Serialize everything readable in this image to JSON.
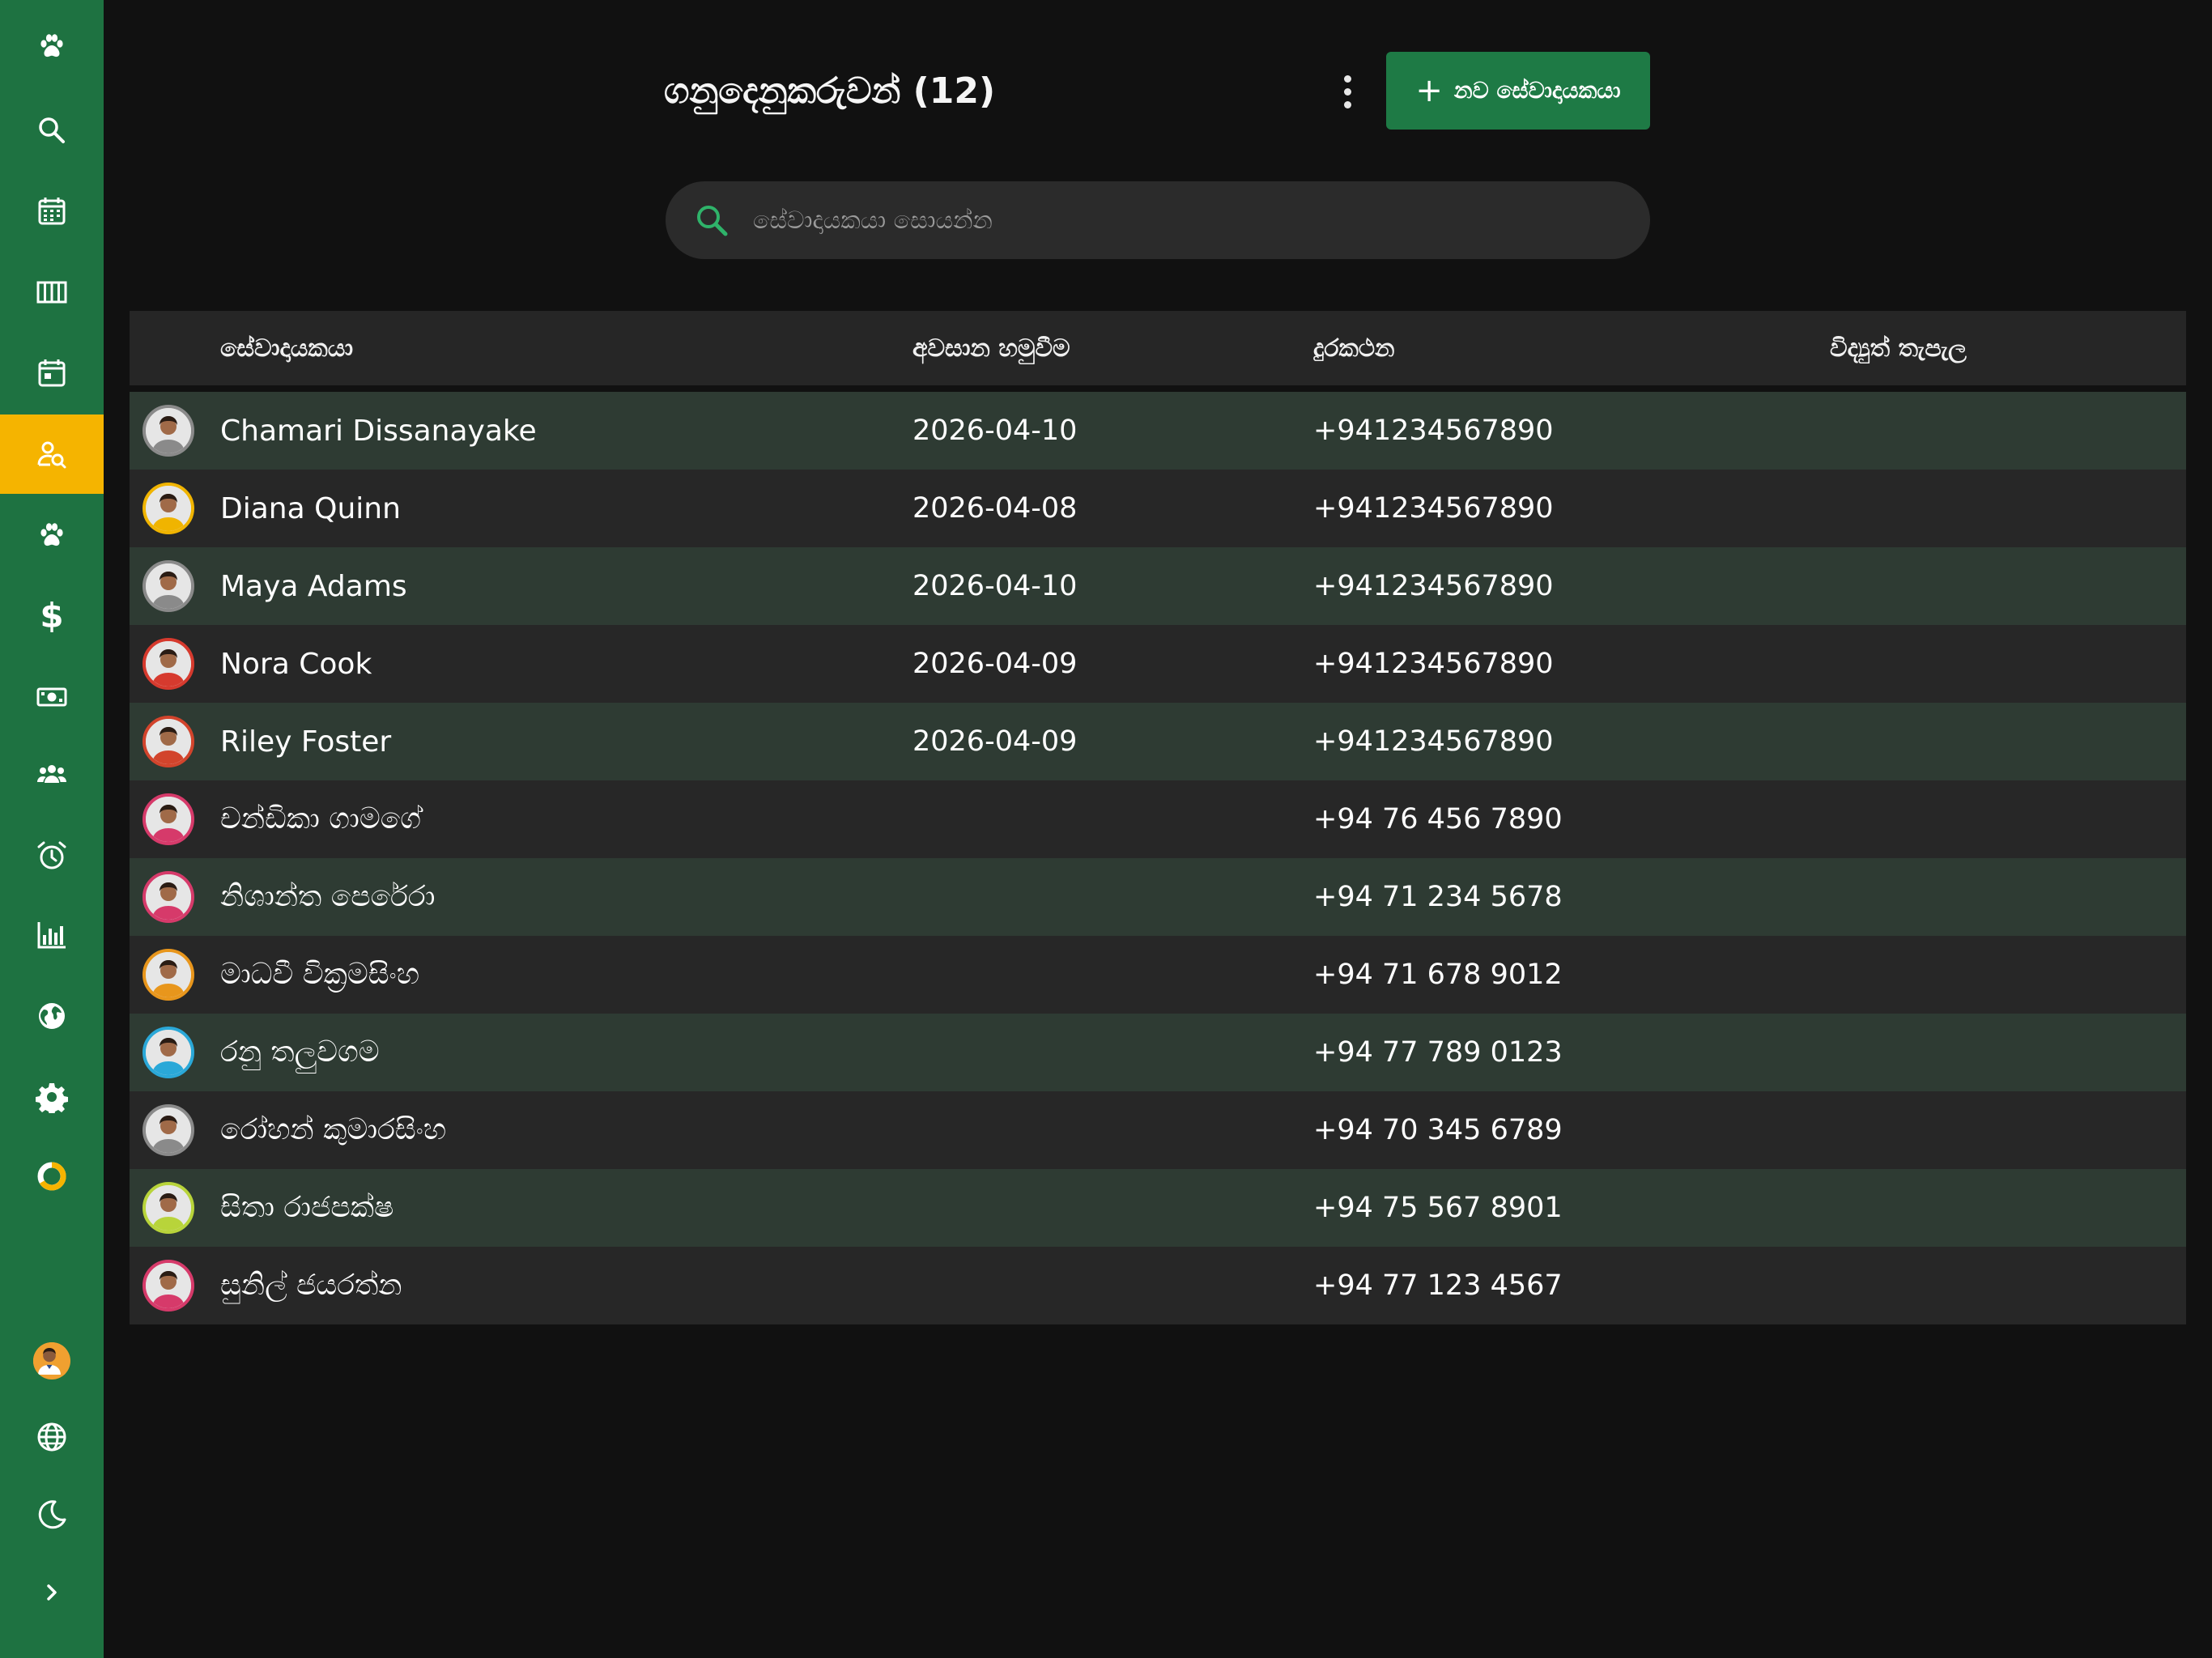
{
  "sidebar": {
    "items": [
      {
        "icon": "paw-logo-icon"
      },
      {
        "icon": "search-icon"
      },
      {
        "icon": "calendar-grid-icon"
      },
      {
        "icon": "columns-icon"
      },
      {
        "icon": "calendar-day-icon"
      },
      {
        "icon": "user-search-icon",
        "active": true
      },
      {
        "icon": "paw-icon"
      },
      {
        "icon": "dollar-icon",
        "label": "$"
      },
      {
        "icon": "banknote-icon"
      },
      {
        "icon": "users-group-icon"
      },
      {
        "icon": "alarm-clock-icon"
      },
      {
        "icon": "bar-chart-icon"
      },
      {
        "icon": "globe-filled-icon"
      },
      {
        "icon": "settings-gear-icon"
      },
      {
        "icon": "progress-ring-icon"
      }
    ],
    "bottom": [
      {
        "icon": "user-avatar"
      },
      {
        "icon": "language-globe-icon"
      },
      {
        "icon": "moon-icon"
      },
      {
        "icon": "chevron-right-icon"
      }
    ],
    "active_color": "#f5b400",
    "background_color": "#1e7241"
  },
  "header": {
    "title": "ගනුදෙනුකරුවන් (12)",
    "add_button_label": "නව සේවාදායකයා",
    "add_button_color": "#1e7a45"
  },
  "search": {
    "placeholder": "සේවාදායකයා සොයන්න",
    "value": ""
  },
  "table": {
    "columns": [
      "සේවාදායකයා",
      "අවසාන හමුවීම",
      "දුරකථන",
      "විද්‍යුත් තැපැල"
    ],
    "rows": [
      {
        "name": "Chamari Dissanayake",
        "last_visit": "2026-04-10",
        "phone": "+941234567890",
        "email": "",
        "avatar_color": "#8a8a8a"
      },
      {
        "name": "Diana Quinn",
        "last_visit": "2026-04-08",
        "phone": "+941234567890",
        "email": "",
        "avatar_color": "#f0b400"
      },
      {
        "name": "Maya Adams",
        "last_visit": "2026-04-10",
        "phone": "+941234567890",
        "email": "",
        "avatar_color": "#8a8a8a"
      },
      {
        "name": "Nora Cook",
        "last_visit": "2026-04-09",
        "phone": "+941234567890",
        "email": "",
        "avatar_color": "#d63a2e"
      },
      {
        "name": "Riley Foster",
        "last_visit": "2026-04-09",
        "phone": "+941234567890",
        "email": "",
        "avatar_color": "#d2442c"
      },
      {
        "name": "චන්ඩිකා ගාමගේ",
        "last_visit": "",
        "phone": "+94 76 456 7890",
        "email": "",
        "avatar_color": "#d63a6a"
      },
      {
        "name": "නිශාන්ත පෙරේරා",
        "last_visit": "",
        "phone": "+94 71 234 5678",
        "email": "",
        "avatar_color": "#d63a6a"
      },
      {
        "name": "මාධවී වික්‍රමසිංහ",
        "last_visit": "",
        "phone": "+94 71 678 9012",
        "email": "",
        "avatar_color": "#e8961c"
      },
      {
        "name": "රනු තලුවගම",
        "last_visit": "",
        "phone": "+94 77 789 0123",
        "email": "",
        "avatar_color": "#2aa8d8"
      },
      {
        "name": "රෝහන් කුමාරසිංහ",
        "last_visit": "",
        "phone": "+94 70 345 6789",
        "email": "",
        "avatar_color": "#8a8a8a"
      },
      {
        "name": "සිතා රාජපක්ෂ",
        "last_visit": "",
        "phone": "+94 75 567 8901",
        "email": "",
        "avatar_color": "#b8d43a"
      },
      {
        "name": "සුනිල් ජයරත්න",
        "last_visit": "",
        "phone": "+94 77 123 4567",
        "email": "",
        "avatar_color": "#d63a6a"
      }
    ]
  }
}
